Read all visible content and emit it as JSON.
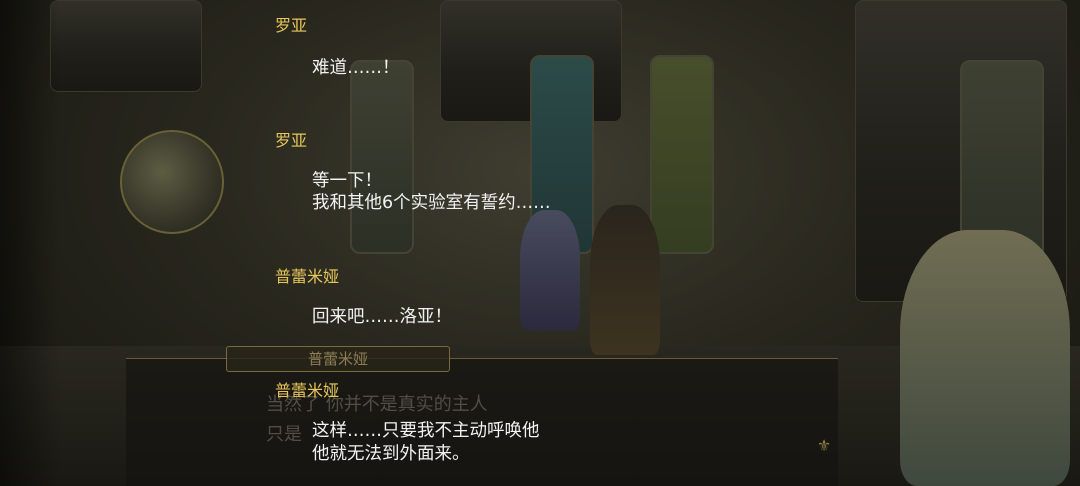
{
  "log_entries": [
    {
      "speaker": "罗亚",
      "lines": [
        "难道……！"
      ]
    },
    {
      "speaker": "罗亚",
      "lines": [
        "等一下！",
        "我和其他6个实验室有誓约……"
      ]
    },
    {
      "speaker": "普蕾米娅",
      "lines": [
        "回来吧……洛亚！"
      ]
    },
    {
      "speaker": "普蕾米娅",
      "lines": [
        "这样……只要我不主动呼唤他",
        "他就无法到外面来。"
      ]
    }
  ],
  "background_dialog": {
    "name": "普蕾米娅",
    "line1_fragment": "当然了 你并不是真实的主人",
    "line2_fragment": "只是"
  }
}
